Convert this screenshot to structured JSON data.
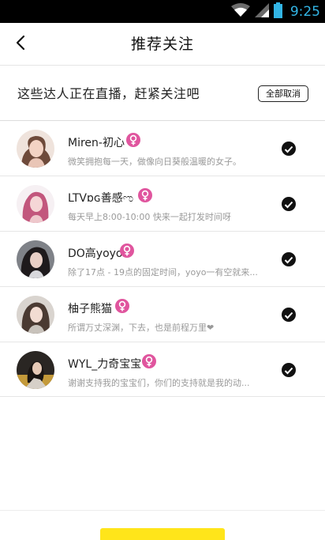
{
  "status_bar": {
    "time": "9:25",
    "icons": [
      "wifi-icon",
      "signal-icon",
      "battery-icon"
    ]
  },
  "header": {
    "title": "推荐关注",
    "back_icon": "back-arrow-icon"
  },
  "banner": {
    "text": "这些达人正在直播，赶紧关注吧",
    "cancel_all_label": "全部取消"
  },
  "users": [
    {
      "name": "Miren-初心",
      "gender": "female",
      "desc": "微笑拥抱每一天，做像向日葵般温暖的女子。",
      "selected": true,
      "avatar_color": "#c79a86"
    },
    {
      "name": "LTVɒɢ善感ಌ",
      "gender": "female",
      "desc": "每天早上8:00-10:00 快来一起打发时间呀",
      "selected": true,
      "avatar_color": "#d07aa0"
    },
    {
      "name": "DO高yoyo",
      "gender": "female",
      "desc": "除了17点 - 19点的固定时间，yoyo一有空就来...",
      "selected": true,
      "avatar_color": "#5a5a63"
    },
    {
      "name": "柚子熊猫",
      "gender": "female",
      "desc": "所谓万丈深渊，下去，也是前程万里❤",
      "selected": true,
      "avatar_color": "#8c7a6e"
    },
    {
      "name": "WYL_力奇宝宝",
      "gender": "female",
      "desc": "谢谢支持我的宝宝们，你们的支持就是我的动...",
      "selected": true,
      "avatar_color": "#3a3530"
    }
  ],
  "colors": {
    "accent": "#ffe51a",
    "female_badge": "#e0559e",
    "status_time": "#33b5e5"
  }
}
